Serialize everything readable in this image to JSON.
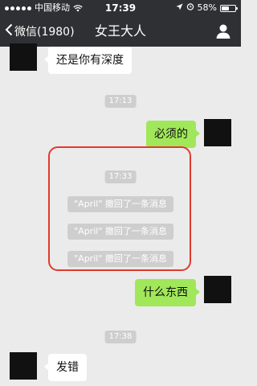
{
  "status_bar": {
    "carrier": "中国移动",
    "time": "17:39",
    "battery": "58%",
    "battery_level": 0.58,
    "signal_dots": 5
  },
  "nav": {
    "back_label": "微信(1980)",
    "title": "女王大人",
    "back_icon": "chevron-left-icon",
    "profile_icon": "person-icon"
  },
  "messages": [
    {
      "side": "left",
      "text": "还是你有深度"
    },
    {
      "side": "right",
      "text": "必须的"
    },
    {
      "side": "right",
      "text": "什么东西"
    },
    {
      "side": "left",
      "text": "发错"
    }
  ],
  "timestamps": [
    "17:13",
    "17:33",
    "17:38"
  ],
  "recall_notices": [
    "\"April\" 撤回了一条消息",
    "\"April\" 撤回了一条消息",
    "\"April\" 撤回了一条消息"
  ],
  "colors": {
    "header_bg": "#2f3033",
    "chat_bg": "#ebebeb",
    "sent_bubble": "#a0e75a",
    "received_bubble": "#ffffff",
    "highlight_border": "#e03a2e"
  }
}
